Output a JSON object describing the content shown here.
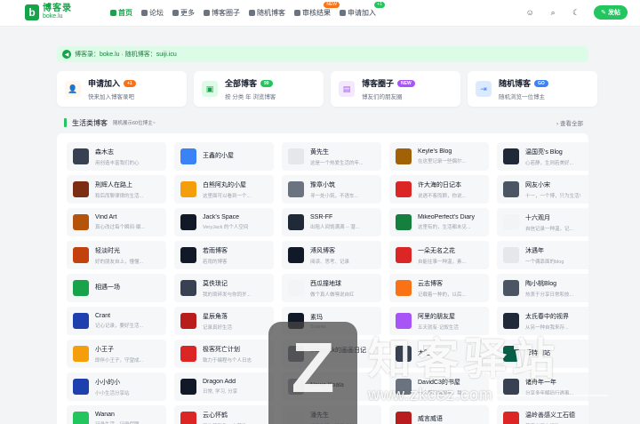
{
  "header": {
    "logo_mark": "b",
    "logo_cn": "博客录",
    "logo_en": "boke.lu",
    "nav": [
      {
        "label": "首页",
        "active": true,
        "badge": ""
      },
      {
        "label": "论坛",
        "active": false,
        "badge": ""
      },
      {
        "label": "更多",
        "active": false,
        "badge": ""
      },
      {
        "label": "博客圈子",
        "active": false,
        "badge": ""
      },
      {
        "label": "随机博客",
        "active": false,
        "badge": ""
      },
      {
        "label": "审核结果",
        "active": false,
        "badge": "NEW"
      },
      {
        "label": "申请加入",
        "active": false,
        "badge": "+1"
      }
    ],
    "submit_label": "发帖"
  },
  "notice": {
    "text": "博客录：boke.lu · 随机博客：suiji.icu"
  },
  "cards": [
    {
      "title": "申请加入",
      "badge": "+1",
      "badge_color": "#f97316",
      "sub": "快来加入博客录吧",
      "icon_bg": "#fff7ed",
      "icon_color": "#f97316",
      "icon": "👤"
    },
    {
      "title": "全部博客",
      "badge": "99",
      "badge_color": "#22c55e",
      "sub": "按 分类 年 浏览博客",
      "icon_bg": "#dcfce7",
      "icon_color": "#16a34a",
      "icon": "▣"
    },
    {
      "title": "博客圈子",
      "badge": "NEW",
      "badge_color": "#a855f7",
      "sub": "博友们的朋友圈",
      "icon_bg": "#f3e8ff",
      "icon_color": "#a855f7",
      "icon": "▤"
    },
    {
      "title": "随机博客",
      "badge": "GO",
      "badge_color": "#3b82f6",
      "sub": "随机浏览一位博主",
      "icon_bg": "#dbeafe",
      "icon_color": "#3b82f6",
      "icon": "⇥"
    }
  ],
  "section": {
    "title": "生活类博客",
    "subtitle": "随机展示60位博主~",
    "more": "查看全部"
  },
  "blogs": [
    {
      "name": "森木志",
      "desc": "用创造丰富我们的心",
      "color": "#374151"
    },
    {
      "name": "王鑫的小屋",
      "desc": "",
      "color": "#3b82f6"
    },
    {
      "name": "黄先生",
      "desc": "这是一个热爱生活的年...",
      "color": "#e5e7eb"
    },
    {
      "name": "Keyle's Blog",
      "desc": "在这里记录一些偶尔...",
      "color": "#a16207"
    },
    {
      "name": "温国亮's Blog",
      "desc": "心若静，生则若美好...",
      "color": "#1f2937"
    },
    {
      "name": "刑辉人在路上",
      "desc": "和后而聊律律的生活...",
      "color": "#7c2d12"
    },
    {
      "name": "白熊阿丸的小屋",
      "desc": "这里面可以看到一个...",
      "color": "#f59e0b"
    },
    {
      "name": "豫章小筑",
      "desc": "寻一处小筑，不语车...",
      "color": "#6b7280"
    },
    {
      "name": "许大海的日记本",
      "desc": "说遇不客而顾，你说...",
      "color": "#dc2626"
    },
    {
      "name": "网友小宋",
      "desc": "十一，一个博，只为生活!",
      "color": "#4b5563"
    },
    {
      "name": "Vind Art",
      "desc": "真心改过每个瞬间·摄...",
      "color": "#b45309"
    },
    {
      "name": "Jack's Space",
      "desc": "VeryJack 的个人空间",
      "color": "#111827"
    },
    {
      "name": "SSR-FF",
      "desc": "出租人间饱满满 -- 潜...",
      "color": "#1f2937"
    },
    {
      "name": "MikeoPerfect's Diary",
      "desc": "这里有的，生活都未见...",
      "color": "#15803d"
    },
    {
      "name": "十六观月",
      "desc": "自信记录一种温，记...",
      "color": "#f3f4f6"
    },
    {
      "name": "轻淡时光",
      "desc": "好的朋友自上，懂懂...",
      "color": "#c2410c"
    },
    {
      "name": "若雨博客",
      "desc": "若雨的博客",
      "color": "#111827"
    },
    {
      "name": "溥风博客",
      "desc": "阅读、思考、记录",
      "color": "#111827"
    },
    {
      "name": "一朵无名之花",
      "desc": "自能往事一种温，素...",
      "color": "#dc2626"
    },
    {
      "name": "沐遇年",
      "desc": "一个偶靠面的blog",
      "color": "#e5e7eb"
    },
    {
      "name": "相遇一场",
      "desc": "",
      "color": "#16a34a"
    },
    {
      "name": "莫佚琐记",
      "desc": "我的琐碎发与你同岁...",
      "color": "#374151"
    },
    {
      "name": "西瓜撞地球",
      "desc": "做个真人做嘿说自红",
      "color": "#f3f4f6"
    },
    {
      "name": "云志博客",
      "desc": "记载着一种的，以后...",
      "color": "#f97316"
    },
    {
      "name": "陶小桃Blog",
      "desc": "热衷于分享日常和技...",
      "color": "#4b5563"
    },
    {
      "name": "Crant",
      "desc": "记心记录，要好生活...",
      "color": "#1e40af"
    },
    {
      "name": "星辰角落",
      "desc": "记录真好生活",
      "color": "#b91c1c"
    },
    {
      "name": "素玛",
      "desc": "Soanta",
      "color": "#111827"
    },
    {
      "name": "阿里的朋友屋",
      "desc": "五天就有·记叙生活",
      "color": "#a855f7"
    },
    {
      "name": "太氏春中的视界",
      "desc": "从另一种自我来存...",
      "color": "#1f2937"
    },
    {
      "name": "小王子",
      "desc": "即伴小王子，守望成...",
      "color": "#f59e0b"
    },
    {
      "name": "极客死亡计划",
      "desc": "致力于编程与个人日志",
      "color": "#dc2626"
    },
    {
      "name": "Maverick的画画日记",
      "desc": "...",
      "color": "#6b7280"
    },
    {
      "name": "太阳",
      "desc": "",
      "color": "#374151"
    },
    {
      "name": "菲特网站",
      "desc": "",
      "color": "#065f46"
    },
    {
      "name": "小小的小",
      "desc": "小小生活分享站",
      "color": "#1e40af"
    },
    {
      "name": "Dragon Add",
      "desc": "日常, 学习, 分享",
      "color": "#111827"
    },
    {
      "name": "Nawe Koala",
      "desc": "",
      "color": "#9ca3af"
    },
    {
      "name": "DavidC3的书屋",
      "desc": "一人里门与阅与，我...",
      "color": "#6b7280"
    },
    {
      "name": "诸舟年一年",
      "desc": "分享多年解码行遇事...",
      "color": "#374151"
    },
    {
      "name": "Wanan",
      "desc": "记录生活，记录保障",
      "color": "#22c55e"
    },
    {
      "name": "云心怀鹤",
      "desc": "再先精影象，文艺欲...",
      "color": "#dc2626"
    },
    {
      "name": "潘先生",
      "desc": "记录生活，记录成长",
      "color": "#f3f4f6"
    },
    {
      "name": "威言威语",
      "desc": "",
      "color": "#b91c1c"
    },
    {
      "name": "温岭善感义工石德",
      "desc": "善事义工在行动",
      "color": "#dc2626"
    }
  ],
  "watermark": {
    "logo": "Z",
    "text": "知客驿站",
    "url": "www.zkcez.com"
  }
}
